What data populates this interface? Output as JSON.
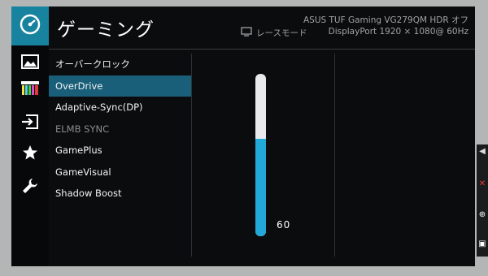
{
  "header": {
    "title": "ゲーミング",
    "model_info": "ASUS TUF Gaming  VG279QM  HDR オフ",
    "mode_label": "レースモード",
    "input_info": "DisplayPort   1920 × 1080@   60Hz"
  },
  "sidebar": {
    "icons": [
      "gauge-icon",
      "image-icon",
      "color-bars-icon",
      "input-icon",
      "star-icon",
      "wrench-icon"
    ]
  },
  "menu": {
    "items": [
      {
        "label": "オーバークロック"
      },
      {
        "label": "OverDrive"
      },
      {
        "label": "Adaptive-Sync(DP)"
      },
      {
        "label": "ELMB SYNC"
      },
      {
        "label": "GamePlus"
      },
      {
        "label": "GameVisual"
      },
      {
        "label": "Shadow Boost"
      }
    ]
  },
  "slider": {
    "value": "60",
    "level": 0.6
  },
  "colors": {
    "accent": "#17839f",
    "selected": "#1a5f7a",
    "slider_fill": "#22a8d9"
  }
}
